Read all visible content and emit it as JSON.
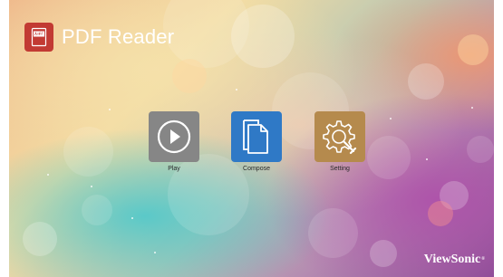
{
  "header": {
    "app_title": "PDF Reader",
    "logo_icon": "pdf-document-icon",
    "logo_color": "#c23a33"
  },
  "launchers": [
    {
      "id": "play",
      "label": "Play",
      "icon": "play-circle-icon",
      "color": "#868686"
    },
    {
      "id": "compose",
      "label": "Compose",
      "icon": "document-pages-icon",
      "color": "#2f79c6"
    },
    {
      "id": "setting",
      "label": "Setting",
      "icon": "gear-wrench-icon",
      "color": "#b58a4d"
    }
  ],
  "footer": {
    "brand": "ViewSonic",
    "brand_mark": "®"
  }
}
